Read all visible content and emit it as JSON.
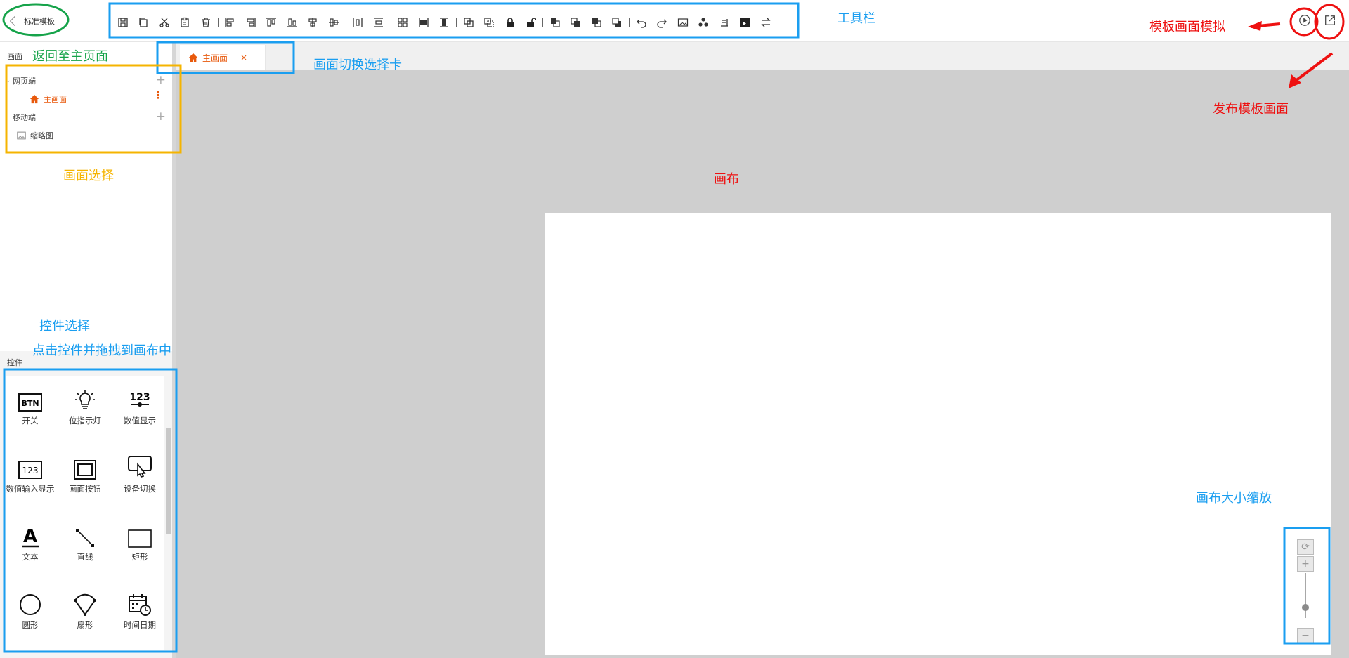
{
  "topbar": {
    "back_label": "标准模板",
    "toolbar_icons": [
      "save-icon",
      "copy-icon",
      "cut-icon",
      "paste-icon",
      "delete-icon",
      "align-left-icon",
      "align-right-icon",
      "align-top-icon",
      "align-bottom-icon",
      "align-hcenter-icon",
      "align-vcenter-icon",
      "distribute-h-icon",
      "distribute-v-icon",
      "group-icon",
      "same-width-icon",
      "same-height-icon",
      "layer-merge-icon",
      "layer-split-icon",
      "lock-icon",
      "unlock-icon",
      "bring-front-icon",
      "bring-forward-icon",
      "send-backward-icon",
      "send-back-icon",
      "undo-icon",
      "redo-icon",
      "image-icon",
      "components-icon",
      "import-icon",
      "video-icon",
      "swap-icon"
    ],
    "actions": [
      "play-icon",
      "publish-icon"
    ]
  },
  "left_panel": {
    "screen_title": "画面",
    "tree": {
      "web_label": "网页端",
      "main_screen_label": "主画面",
      "mobile_label": "移动端",
      "thumbnail_label": "缩略图"
    },
    "controls_title": "控件",
    "controls": [
      {
        "label": "开关",
        "icon": "btn-icon"
      },
      {
        "label": "位指示灯",
        "icon": "bulb-icon"
      },
      {
        "label": "数值显示",
        "icon": "number-display-icon"
      },
      {
        "label": "数值输入显示",
        "icon": "number-input-icon"
      },
      {
        "label": "画面按钮",
        "icon": "screen-button-icon"
      },
      {
        "label": "设备切换",
        "icon": "device-switch-icon"
      },
      {
        "label": "文本",
        "icon": "text-icon"
      },
      {
        "label": "直线",
        "icon": "line-icon"
      },
      {
        "label": "矩形",
        "icon": "rectangle-icon"
      },
      {
        "label": "圆形",
        "icon": "circle-icon"
      },
      {
        "label": "扇形",
        "icon": "sector-icon"
      },
      {
        "label": "时间日期",
        "icon": "datetime-icon"
      }
    ]
  },
  "tabs": [
    {
      "label": "主画面",
      "close": "×"
    }
  ],
  "annotations": {
    "toolbar": "工具栏",
    "simulate": "模板画面模拟",
    "publish": "发布模板画面",
    "back_home": "返回至主页面",
    "tab_switch": "画面切换选择卡",
    "canvas": "画布",
    "screen_select": "画面选择",
    "control_select": "控件选择",
    "drag_hint": "点击控件并拖拽到画布中",
    "zoom": "画布大小缩放"
  },
  "colors": {
    "accent": "#e8590c",
    "annotation_blue": "#1a9ef0",
    "annotation_red": "#ee1111",
    "annotation_green": "#16a34a",
    "annotation_yellow": "#f5b400",
    "workspace": "#cfcfcf"
  }
}
